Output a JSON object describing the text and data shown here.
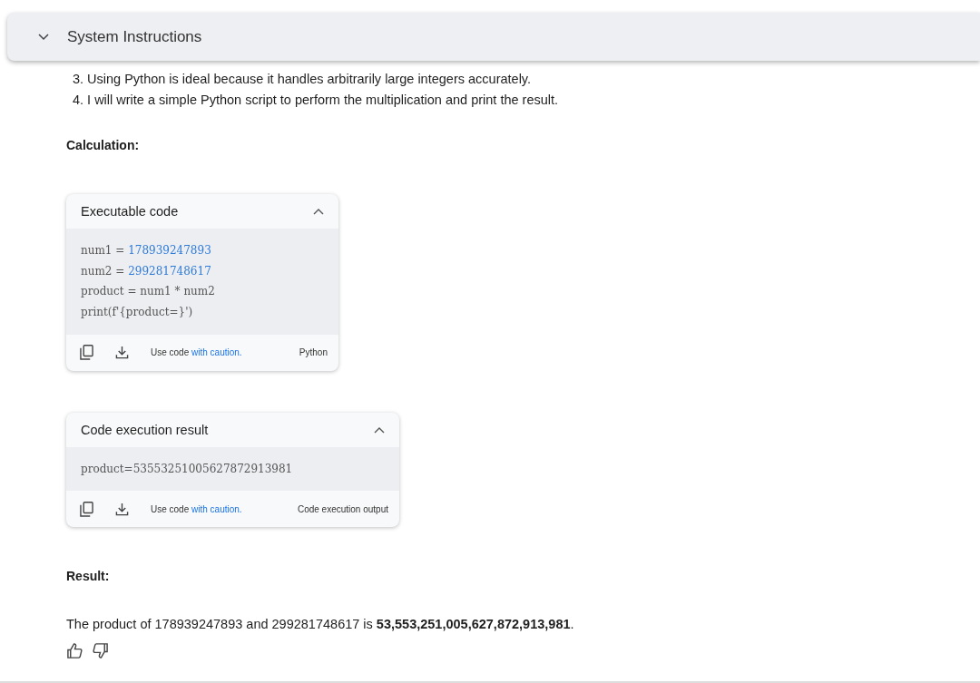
{
  "header": {
    "title": "System Instructions",
    "expanded": false
  },
  "steps": [
    {
      "number": "3.",
      "text": "Using Python is ideal because it handles arbitrarily large integers accurately."
    },
    {
      "number": "4.",
      "text": "I will write a simple Python script to perform the multiplication and print the result."
    }
  ],
  "calculation_heading": "Calculation:",
  "cards": [
    {
      "title": "Executable code",
      "expanded": true,
      "lines": [
        [
          {
            "text": "num1 = ",
            "kind": "plain"
          },
          {
            "text": "178939247893",
            "kind": "number"
          }
        ],
        [
          {
            "text": "num2 = ",
            "kind": "plain"
          },
          {
            "text": "299281748617",
            "kind": "number"
          }
        ],
        [
          {
            "text": "product = num1 * num2",
            "kind": "plain"
          }
        ],
        [
          {
            "text": "print(f'{product=}')",
            "kind": "plain"
          }
        ]
      ],
      "caution_prefix": "Use code",
      "caution_link": "with caution.",
      "language": "Python"
    },
    {
      "title": "Code execution result",
      "expanded": true,
      "lines": [
        [
          {
            "text": "product=53553251005627872913981",
            "kind": "plain"
          }
        ]
      ],
      "caution_prefix": "Use code",
      "caution_link": "with caution.",
      "language": "Code execution output"
    }
  ],
  "result_heading": "Result:",
  "result_text": "The product of 178939247893 and 299281748617 is **53,553,251,005,627,872,913,981**."
}
